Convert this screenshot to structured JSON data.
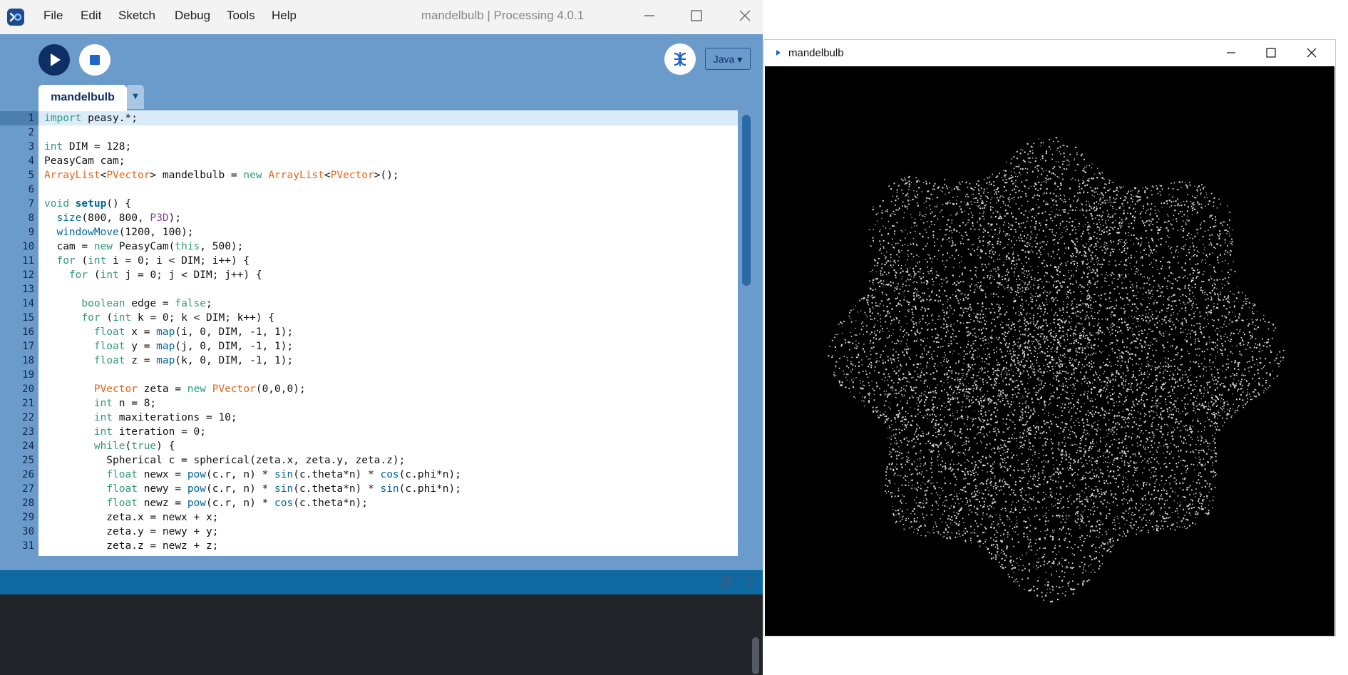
{
  "ide": {
    "window_title": "mandelbulb | Processing 4.0.1",
    "menu": [
      "File",
      "Edit",
      "Sketch",
      "Debug",
      "Tools",
      "Help"
    ],
    "mode": "Java ▾",
    "tab": "mandelbulb",
    "tab_arrow": "▼",
    "code_lines": [
      "import peasy.*;",
      "",
      "int DIM = 128;",
      "PeasyCam cam;",
      "ArrayList<PVector> mandelbulb = new ArrayList<PVector>();",
      "",
      "void setup() {",
      "  size(800, 800, P3D);",
      "  windowMove(1200, 100);",
      "  cam = new PeasyCam(this, 500);",
      "  for (int i = 0; i < DIM; i++) {",
      "    for (int j = 0; j < DIM; j++) {",
      "",
      "      boolean edge = false;",
      "      for (int k = 0; k < DIM; k++) {",
      "        float x = map(i, 0, DIM, -1, 1);",
      "        float y = map(j, 0, DIM, -1, 1);",
      "        float z = map(k, 0, DIM, -1, 1);",
      "",
      "        PVector zeta = new PVector(0,0,0);",
      "        int n = 8;",
      "        int maxiterations = 10;",
      "        int iteration = 0;",
      "        while(true) {",
      "          Spherical c = spherical(zeta.x, zeta.y, zeta.z);",
      "          float newx = pow(c.r, n) * sin(c.theta*n) * cos(c.phi*n);",
      "          float newy = pow(c.r, n) * sin(c.theta*n) * sin(c.phi*n);",
      "          float newz = pow(c.r, n) * cos(c.theta*n);",
      "          zeta.x = newx + x;",
      "          zeta.y = newy + y;",
      "          zeta.z = newz + z;"
    ],
    "current_line": 1,
    "icons": {
      "logo": "processing-logo-icon",
      "run": "play-icon",
      "stop": "stop-icon",
      "debug": "butterfly-debug-icon"
    },
    "colors": {
      "frame": "#6b9bca",
      "run_button": "#0d2f66",
      "status_bar": "#0d69a0",
      "console": "#212529",
      "keyword": "#33997e",
      "type": "#e2661a",
      "function": "#006699"
    }
  },
  "sketch": {
    "title": "mandelbulb",
    "canvas_background": "#000000",
    "point_color": "#ffffff"
  }
}
